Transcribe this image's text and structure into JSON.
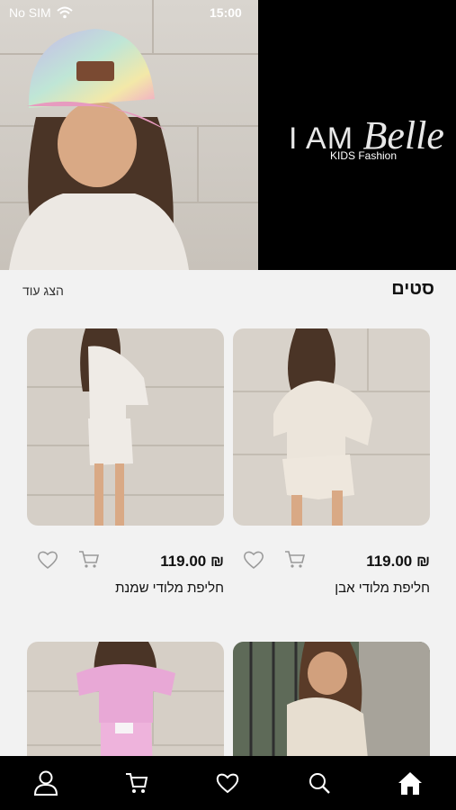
{
  "status_bar": {
    "carrier": "No SIM",
    "time": "15:00"
  },
  "brand": {
    "prefix": "I AM",
    "name": "Belle",
    "subtitle": "KIDS Fashion"
  },
  "section": {
    "title": "סטים",
    "show_more": "הצג עוד"
  },
  "products": [
    {
      "name": "חליפת מלודי אבן",
      "price": "₪ 119.00"
    },
    {
      "name": "חליפת מלודי שמנת",
      "price": "₪ 119.00"
    },
    {
      "name": "",
      "price": ""
    },
    {
      "name": "",
      "price": ""
    }
  ],
  "tabbar": [
    "user-icon",
    "cart-icon",
    "heart-icon",
    "search-icon",
    "home-icon"
  ],
  "colors": {
    "background": "#f2f2f2",
    "brand_black": "#000000",
    "tabbar": "#000000"
  }
}
